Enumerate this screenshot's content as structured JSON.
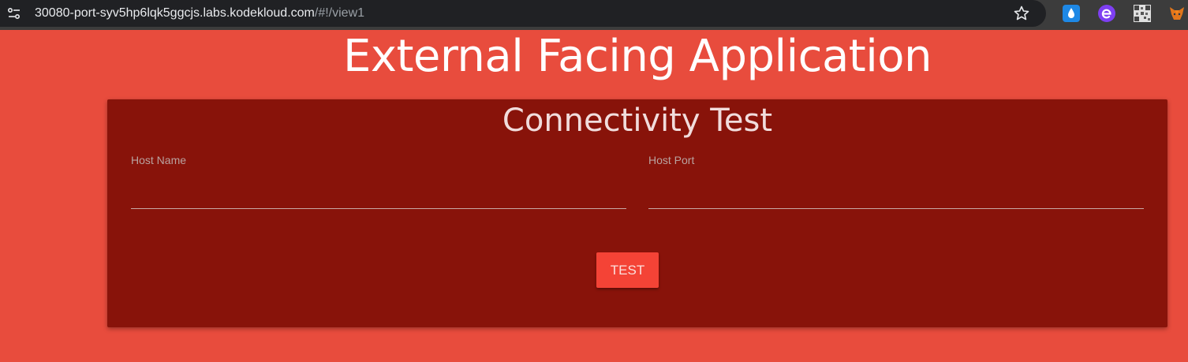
{
  "browser": {
    "url_host": "30080-port-syv5hp6lqk5ggcjs.labs.kodekloud.com",
    "url_path": "/#!/view1",
    "extensions": [
      {
        "icon": "water-drop-icon",
        "color": "#1e88e5"
      },
      {
        "icon": "e-logo-icon",
        "color": "#7e3ff2"
      },
      {
        "icon": "qr-code-icon",
        "color": "#bdbdbd"
      },
      {
        "icon": "fox-icon",
        "color": "#e2761b"
      }
    ]
  },
  "page": {
    "title": "External Facing Application",
    "background_color": "#e84c3d"
  },
  "card": {
    "title": "Connectivity Test",
    "background_color": "#88130a",
    "host_name_label": "Host Name",
    "host_name_value": "",
    "host_port_label": "Host Port",
    "host_port_value": "",
    "test_button_label": "TEST",
    "button_color": "#f44336"
  }
}
